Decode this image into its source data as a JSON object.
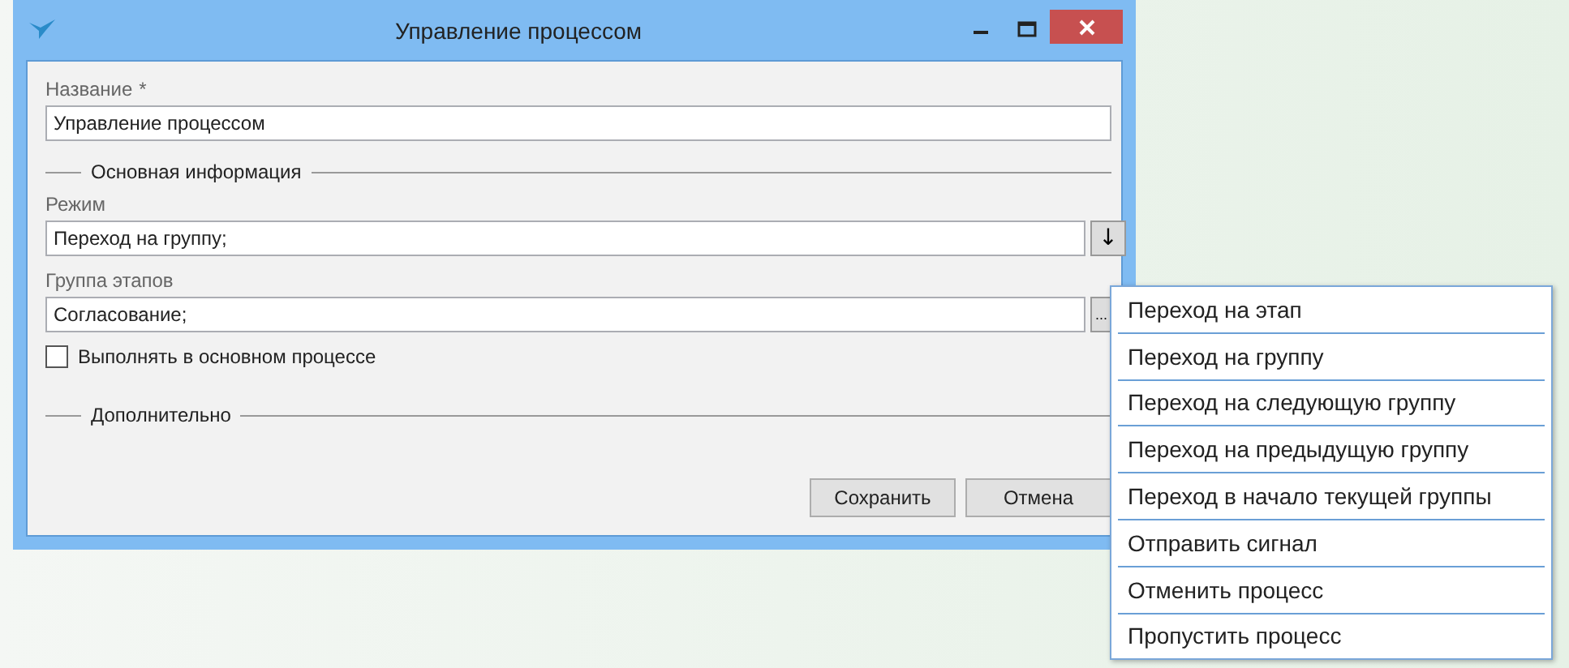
{
  "window": {
    "title": "Управление процессом"
  },
  "name_field": {
    "label": "Название",
    "required_mark": "*",
    "value": "Управление процессом"
  },
  "sections": [
    {
      "title": "Основная информация"
    },
    {
      "title": "Дополнительно"
    }
  ],
  "mode_field": {
    "label": "Режим",
    "value": "Переход на группу;",
    "button": "↓"
  },
  "group_field": {
    "label": "Группа этапов",
    "value": "Согласование;",
    "button": "..."
  },
  "checkbox": {
    "label": "Выполнять в основном процессе",
    "checked": false
  },
  "buttons": [
    "Сохранить",
    "Отмена"
  ],
  "menu": [
    {
      "label": "Переход на этап"
    },
    {
      "label": "Переход на группу"
    },
    {
      "label": "Переход на следующую группу"
    },
    {
      "label": "Переход на предыдущую группу"
    },
    {
      "label": "Переход в начало текущей группы"
    },
    {
      "label": "Отправить сигнал"
    },
    {
      "label": "Отменить процесс"
    },
    {
      "label": "Пропустить процесс"
    }
  ]
}
